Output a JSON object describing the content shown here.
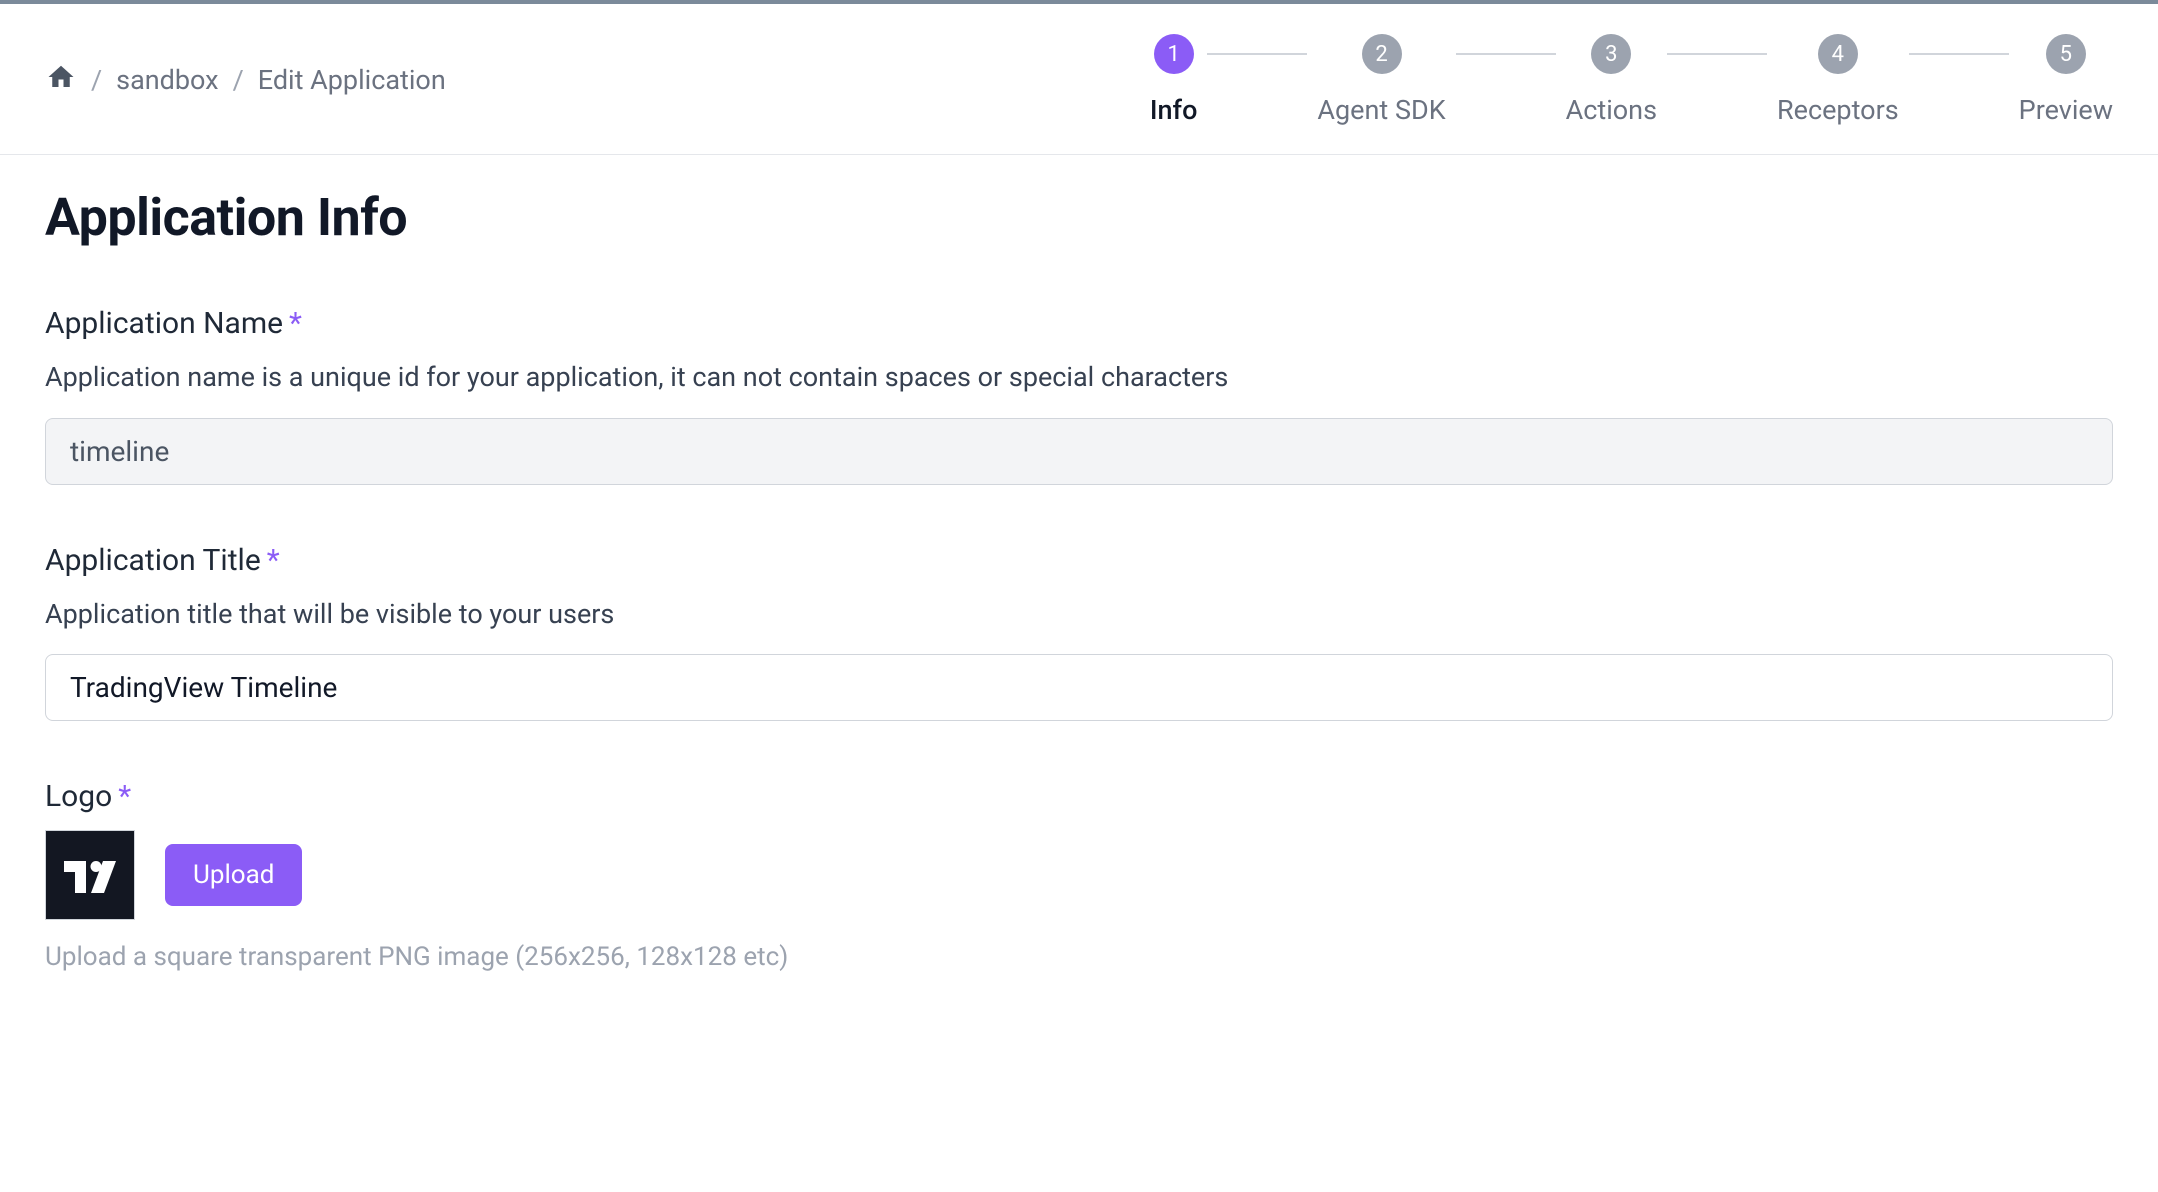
{
  "breadcrumb": {
    "sandbox": "sandbox",
    "edit_application": "Edit Application"
  },
  "stepper": {
    "steps": [
      {
        "num": "1",
        "label": "Info"
      },
      {
        "num": "2",
        "label": "Agent SDK"
      },
      {
        "num": "3",
        "label": "Actions"
      },
      {
        "num": "4",
        "label": "Receptors"
      },
      {
        "num": "5",
        "label": "Preview"
      }
    ]
  },
  "page": {
    "title": "Application Info"
  },
  "form": {
    "name": {
      "label": "Application Name",
      "help": "Application name is a unique id for your application, it can not contain spaces or special characters",
      "value": "timeline"
    },
    "title": {
      "label": "Application Title",
      "help": "Application title that will be visible to your users",
      "value": "TradingView Timeline"
    },
    "logo": {
      "label": "Logo",
      "upload_button": "Upload",
      "help": "Upload a square transparent PNG image (256x256, 128x128 etc)"
    }
  }
}
